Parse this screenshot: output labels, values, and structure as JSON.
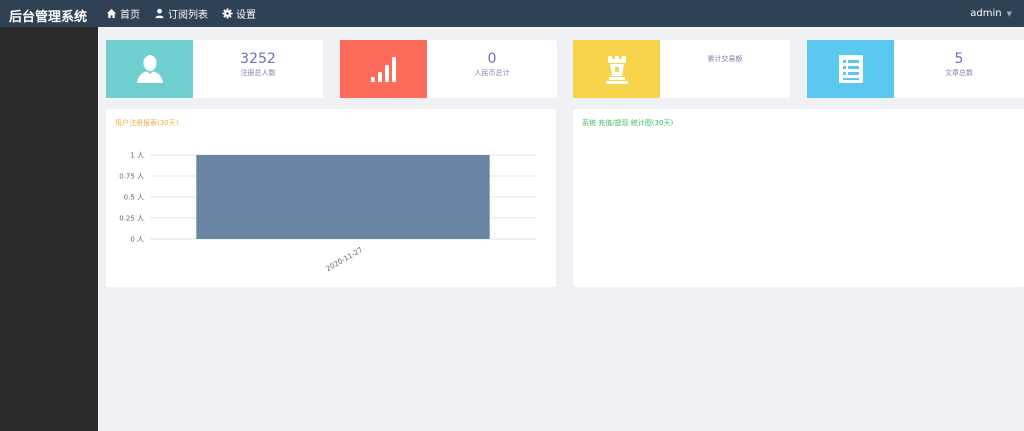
{
  "app": {
    "title": "后台管理系统"
  },
  "nav": [
    {
      "label": "首页",
      "icon": "home-icon"
    },
    {
      "label": "订阅列表",
      "icon": "user-icon"
    },
    {
      "label": "设置",
      "icon": "gear-icon"
    }
  ],
  "user": {
    "name": "admin",
    "caret": "▼"
  },
  "colors": {
    "topbar": "#2f4154",
    "sidebar": "#2a2a2a",
    "teal": "#6fcfcf",
    "coral": "#ff6b5b",
    "yellow": "#f8d44c",
    "sky": "#5bc8ef",
    "bar": "#6a84a3"
  },
  "cards": [
    {
      "value": "3252",
      "label": "注册总人数",
      "icon": "user-silhouette-icon"
    },
    {
      "value": "0",
      "label": "人民币总计",
      "icon": "signal-bars-icon"
    },
    {
      "value": "",
      "label": "累计交易额",
      "icon": "chess-rook-icon"
    },
    {
      "value": "5",
      "label": "文章总数",
      "icon": "list-document-icon"
    }
  ],
  "panels": {
    "left_title": "用户注册报表(30天)",
    "right_title": "系统 充值/提现 统计图(30天)"
  },
  "chart_data": {
    "type": "bar",
    "title": "用户注册报表(30天)",
    "categories": [
      "2020-11-27"
    ],
    "values": [
      1
    ],
    "yticks": [
      "0 人",
      "0.25 人",
      "0.5 人",
      "0.75 人",
      "1 人"
    ],
    "ylim": [
      0,
      1
    ],
    "grid": true
  }
}
